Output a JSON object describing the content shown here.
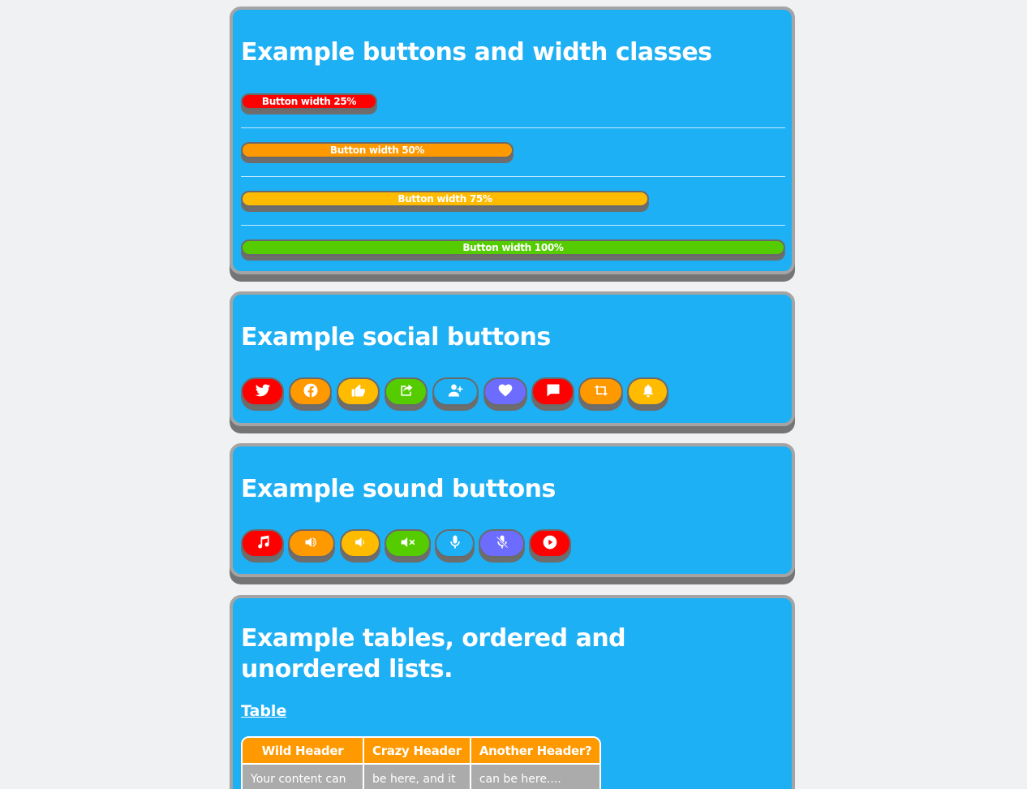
{
  "colors": {
    "card_bg": "#1eb0f4",
    "red": "#ff0000",
    "orange": "#ff9900",
    "amber": "#ffbb00",
    "green": "#55cc00",
    "blue": "#1eb0f4",
    "purple": "#6c6cff"
  },
  "widths_card": {
    "title": "Example buttons and width classes",
    "buttons": [
      {
        "label": "Button width 25%",
        "width_percent": 25,
        "color": "#ff0000"
      },
      {
        "label": "Button width 50%",
        "width_percent": 50,
        "color": "#ff9900"
      },
      {
        "label": "Button width 75%",
        "width_percent": 75,
        "color": "#ffbb00"
      },
      {
        "label": "Button width 100%",
        "width_percent": 100,
        "color": "#55cc00"
      }
    ]
  },
  "social_card": {
    "title": "Example social buttons",
    "buttons": [
      {
        "icon": "twitter-icon",
        "color": "#ff0000"
      },
      {
        "icon": "facebook-icon",
        "color": "#ff9900"
      },
      {
        "icon": "thumbs-up-icon",
        "color": "#ffbb00"
      },
      {
        "icon": "share-icon",
        "color": "#55cc00"
      },
      {
        "icon": "add-user-icon",
        "color": "#1eb0f4"
      },
      {
        "icon": "heart-icon",
        "color": "#6c6cff"
      },
      {
        "icon": "comment-icon",
        "color": "#ff0000"
      },
      {
        "icon": "retweet-icon",
        "color": "#ff9900"
      },
      {
        "icon": "bell-icon",
        "color": "#ffbb00"
      }
    ]
  },
  "sound_card": {
    "title": "Example sound buttons",
    "buttons": [
      {
        "icon": "music-icon",
        "color": "#ff0000"
      },
      {
        "icon": "volume-up-icon",
        "color": "#ff9900"
      },
      {
        "icon": "volume-down-icon",
        "color": "#ffbb00"
      },
      {
        "icon": "volume-mute-icon",
        "color": "#55cc00"
      },
      {
        "icon": "microphone-icon",
        "color": "#1eb0f4"
      },
      {
        "icon": "microphone-off-icon",
        "color": "#6c6cff"
      },
      {
        "icon": "play-icon",
        "color": "#ff0000"
      }
    ]
  },
  "tables_card": {
    "title": "Example tables, ordered and unordered lists.",
    "table_link": "Table",
    "table": {
      "headers": [
        "Wild Header",
        "Crazy Header",
        "Another Header?"
      ],
      "rows": [
        [
          "Your content can",
          "be here, and it",
          "can be here...."
        ]
      ]
    }
  }
}
